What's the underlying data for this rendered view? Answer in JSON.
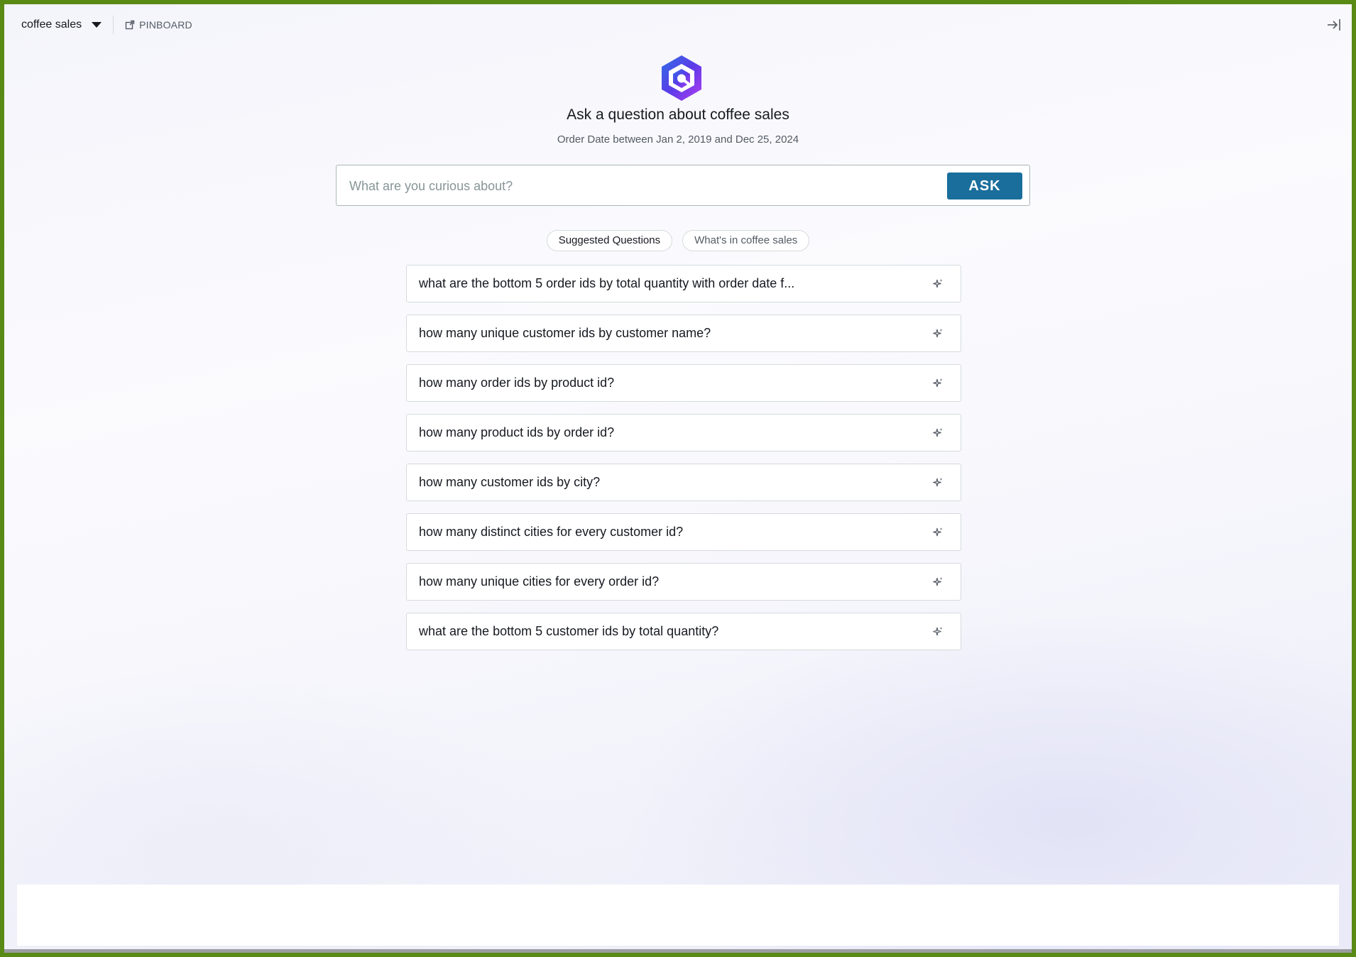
{
  "topbar": {
    "dataset_label": "coffee sales",
    "pinboard_label": "PINBOARD"
  },
  "header": {
    "title": "Ask a question about coffee sales",
    "subtitle": "Order Date between Jan 2, 2019 and Dec 25, 2024"
  },
  "search": {
    "placeholder": "What are you curious about?",
    "value": "",
    "ask_label": "ASK"
  },
  "tabs": [
    {
      "label": "Suggested Questions",
      "active": true
    },
    {
      "label": "What's in coffee sales",
      "active": false
    }
  ],
  "questions": [
    "what are the bottom 5 order ids by total quantity with order date f...",
    "how many unique customer ids by customer name?",
    "how many order ids by product id?",
    "how many product ids by order id?",
    "how many customer ids by city?",
    "how many distinct cities for every customer id?",
    "how many unique cities for every order id?",
    "what are the bottom 5 customer ids by total quantity?"
  ],
  "icons": {
    "logo": "q-hexagon-logo-icon",
    "pinboard": "external-pin-icon",
    "collapse": "collapse-right-icon",
    "question_action": "sparkle-icon"
  },
  "colors": {
    "accent": "#1a6e9c",
    "frame_border": "#5a8a16",
    "logo_gradient_start": "#3b5bdb",
    "logo_gradient_end": "#a53cf0"
  }
}
